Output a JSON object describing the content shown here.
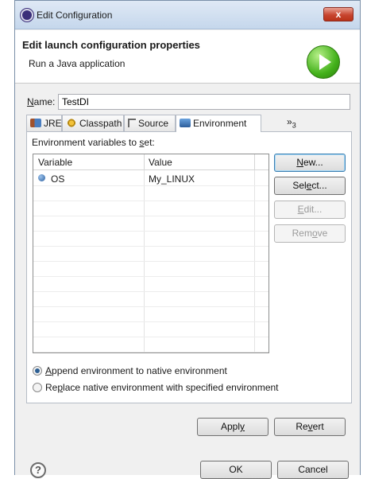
{
  "window": {
    "title": "Edit Configuration",
    "close_label": "x"
  },
  "header": {
    "title": "Edit launch configuration properties",
    "subtitle": "Run a Java application",
    "icon": "run-icon"
  },
  "name": {
    "label_u": "N",
    "label_rest": "ame:",
    "value": "TestDI"
  },
  "tabs": [
    {
      "label": "JRE",
      "icon": "jre-icon"
    },
    {
      "label": "Classpath",
      "icon": "classpath-icon"
    },
    {
      "label": "Source",
      "icon": "source-icon"
    },
    {
      "label": "Environment",
      "icon": "environment-icon",
      "active": true
    }
  ],
  "tabs_overflow": {
    "glyph": "»",
    "count": "3"
  },
  "env": {
    "label_pre": "Environment variables to ",
    "label_u": "s",
    "label_post": "et:",
    "columns": [
      "Variable",
      "Value"
    ],
    "rows": [
      {
        "variable": "OS",
        "value": "My_LINUX"
      }
    ]
  },
  "side_buttons": {
    "new": {
      "u": "N",
      "rest": "ew..."
    },
    "select": {
      "pre": "Sel",
      "u": "e",
      "post": "ct..."
    },
    "edit": {
      "u": "E",
      "rest": "dit..."
    },
    "remove": {
      "pre": "Rem",
      "u": "o",
      "post": "ve"
    }
  },
  "radios": {
    "append": {
      "u": "A",
      "rest": "ppend environment to native environment",
      "checked": true
    },
    "replace": {
      "pre": "Re",
      "u": "p",
      "post": "lace native environment with specified environment",
      "checked": false
    }
  },
  "bottom_buttons": {
    "apply": {
      "pre": "Appl",
      "u": "y",
      "post": ""
    },
    "revert": {
      "pre": "Re",
      "u": "v",
      "post": "ert"
    }
  },
  "dialog_buttons": {
    "ok": "OK",
    "cancel": "Cancel"
  },
  "help": {
    "glyph": "?"
  }
}
